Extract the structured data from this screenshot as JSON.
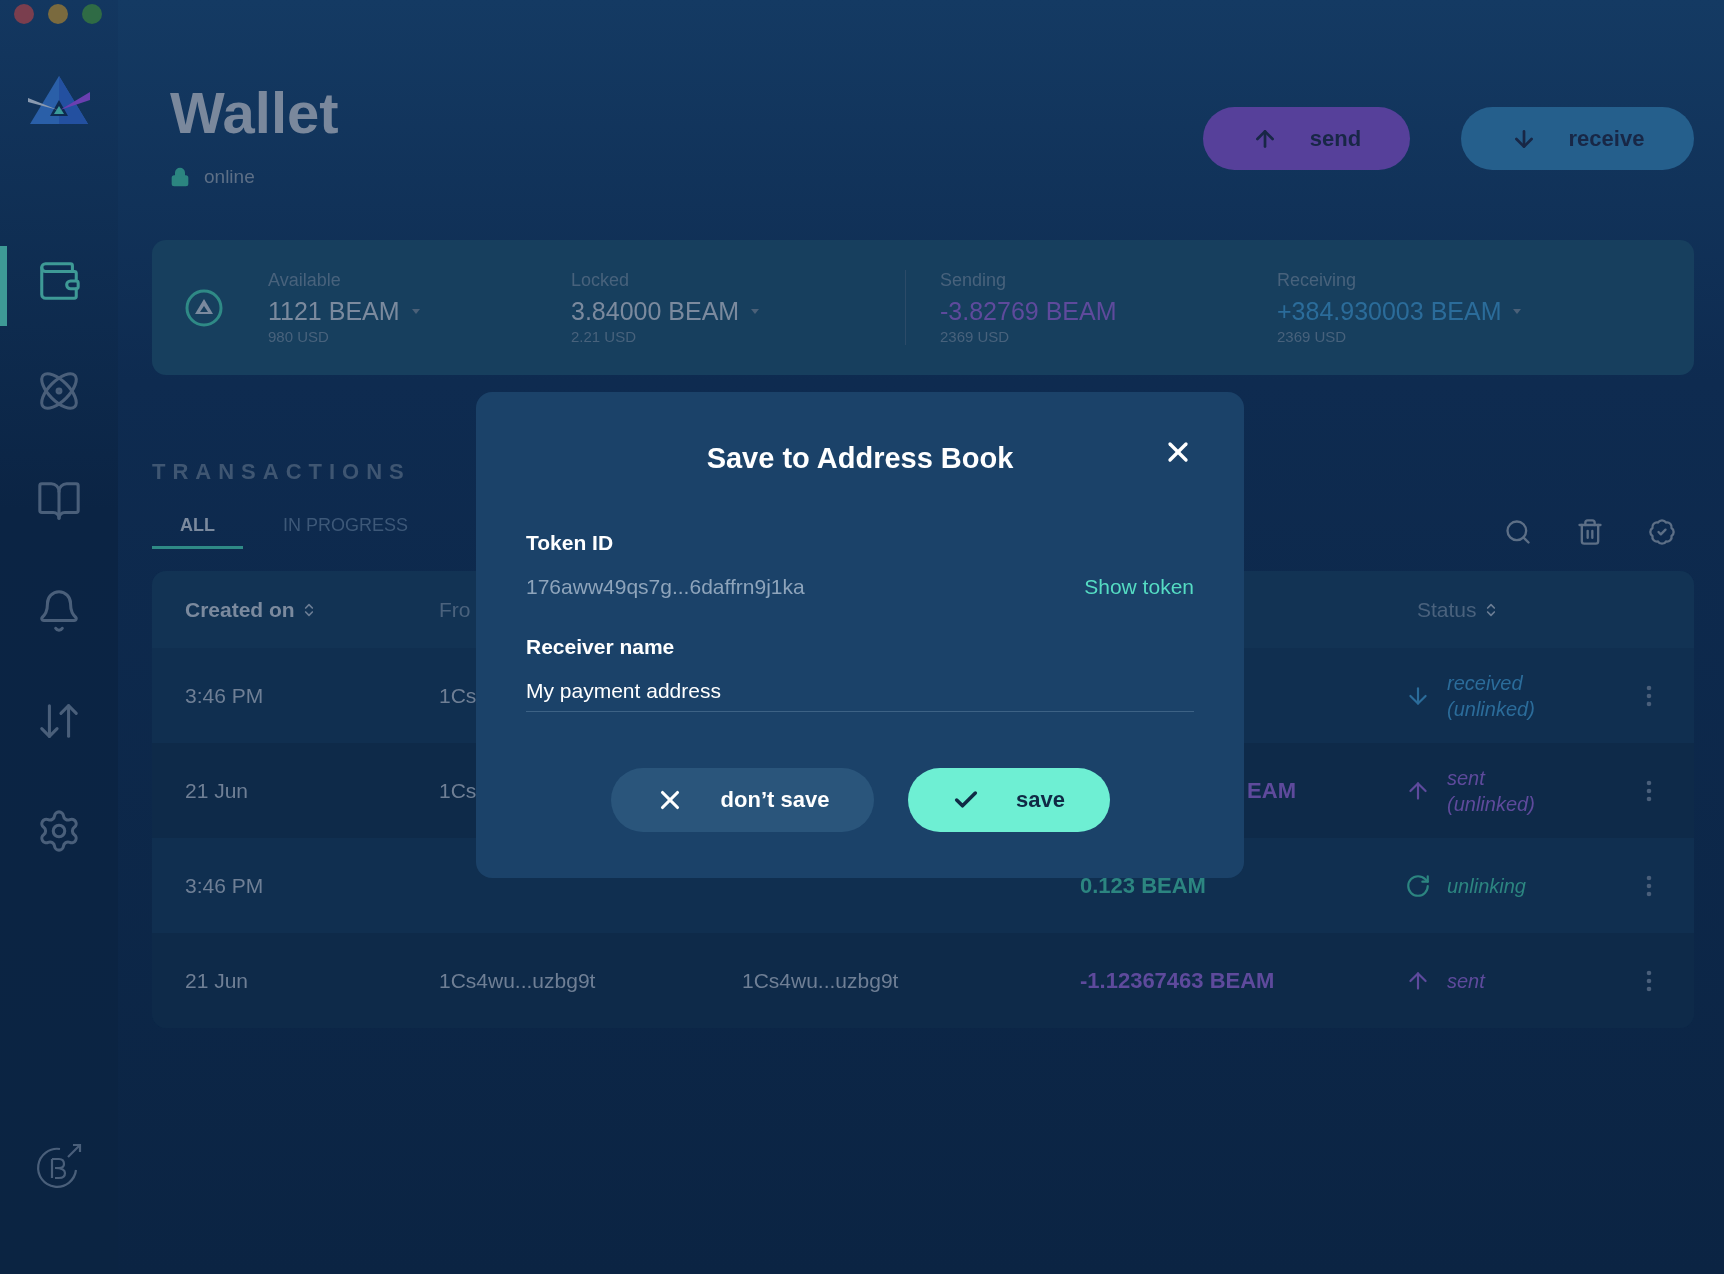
{
  "sidebar": {
    "items": [
      {
        "selected": true
      },
      {
        "selected": false
      },
      {
        "selected": false
      },
      {
        "selected": false
      },
      {
        "selected": false
      },
      {
        "selected": false
      }
    ]
  },
  "header": {
    "title": "Wallet",
    "status": "online",
    "actions": [
      {
        "kind": "send",
        "label": "send"
      },
      {
        "kind": "receive",
        "label": "receive"
      }
    ]
  },
  "summary": [
    {
      "kind": "available",
      "label": "Available",
      "amount": "1121 BEAM",
      "usd": "980 USD",
      "dropdown": true
    },
    {
      "kind": "locked",
      "label": "Locked",
      "amount": "3.84000 BEAM",
      "usd": "2.21 USD",
      "dropdown": true
    },
    {
      "kind": "sending",
      "label": "Sending",
      "amount": "-3.82769 BEAM",
      "usd": "2369 USD",
      "dropdown": false
    },
    {
      "kind": "receiving",
      "label": "Receiving",
      "amount": "+384.930003 BEAM",
      "usd": "2369 USD",
      "dropdown": true
    }
  ],
  "transactions": {
    "title": "TRANSACTIONS",
    "tabs": [
      {
        "label": "ALL",
        "selected": true
      },
      {
        "label": "IN PROGRESS",
        "selected": false
      }
    ],
    "columns": [
      {
        "label": "Created on",
        "sortable": true
      },
      {
        "label": "Fro",
        "sortable": false
      },
      {
        "label": "Status",
        "sortable": true
      }
    ],
    "rows": [
      {
        "kind": "received",
        "created_on": "3:46 PM",
        "from": "1Cs",
        "status": "received (unlinked)"
      },
      {
        "kind": "sent",
        "created_on": "21 Jun",
        "from": "1Cs",
        "amount": "EAM",
        "amount_clipped": true,
        "status": "sent (unlinked)"
      },
      {
        "kind": "unlinking",
        "created_on": "3:46 PM",
        "amount": "0.123 BEAM",
        "status": "unlinking"
      },
      {
        "kind": "sent",
        "created_on": "21 Jun",
        "from": "1Cs4wu...uzbg9t",
        "to": "1Cs4wu...uzbg9t",
        "amount": "-1.12367463 BEAM",
        "status": "sent"
      }
    ]
  },
  "dialog": {
    "title": "Save to Address Book",
    "token_label": "Token ID",
    "token": "176aww49qs7g...6daffrn9j1ka",
    "show_token": "Show token",
    "name_label": "Receiver name",
    "name_value": "My payment address",
    "buttons": [
      {
        "kind": "cancel",
        "label": "don’t save"
      },
      {
        "kind": "confirm",
        "label": "save"
      }
    ]
  }
}
